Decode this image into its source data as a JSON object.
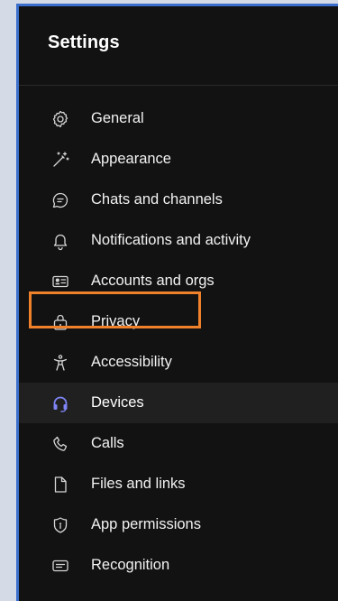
{
  "app": {
    "title": "Settings"
  },
  "nav": {
    "items": [
      {
        "label": "General",
        "icon": "gear-icon"
      },
      {
        "label": "Appearance",
        "icon": "magic-wand-icon"
      },
      {
        "label": "Chats and channels",
        "icon": "chat-icon"
      },
      {
        "label": "Notifications and activity",
        "icon": "bell-icon"
      },
      {
        "label": "Accounts and orgs",
        "icon": "id-card-icon"
      },
      {
        "label": "Privacy",
        "icon": "lock-icon"
      },
      {
        "label": "Accessibility",
        "icon": "accessibility-icon"
      },
      {
        "label": "Devices",
        "icon": "headset-icon",
        "selected": true
      },
      {
        "label": "Calls",
        "icon": "phone-icon"
      },
      {
        "label": "Files and links",
        "icon": "file-icon"
      },
      {
        "label": "App permissions",
        "icon": "shield-icon"
      },
      {
        "label": "Recognition",
        "icon": "caption-icon"
      }
    ]
  },
  "colors": {
    "background": "#121212",
    "window_border": "#3c6ecb",
    "selected_row": "#202020",
    "highlight": "#f0812b",
    "accent_icon": "#7f85f5",
    "text": "#f2f2f2"
  }
}
